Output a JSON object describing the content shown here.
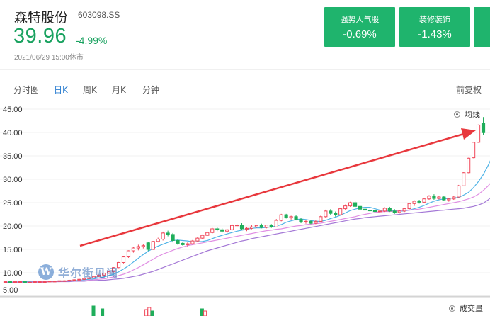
{
  "stock": {
    "name": "森特股份",
    "code": "603098.SS",
    "price": "39.96",
    "change": "-4.99%",
    "timestamp": "2021/06/29 15:00休市"
  },
  "sectors": [
    {
      "name": "强势人气股",
      "value": "-0.69%"
    },
    {
      "name": "装修装饰",
      "value": "-1.43%"
    },
    {
      "name": "",
      "value": ""
    }
  ],
  "tabs": [
    {
      "label": "分时图",
      "active": false
    },
    {
      "label": "日K",
      "active": true
    },
    {
      "label": "周K",
      "active": false
    },
    {
      "label": "月K",
      "active": false
    },
    {
      "label": "分钟",
      "active": false
    }
  ],
  "adjust_label": "前复权",
  "legend": {
    "ma": "均线",
    "volume": "成交量"
  },
  "watermark": {
    "logo": "W",
    "text": "华尔街见闻"
  },
  "colors": {
    "up": "#f0485a",
    "down": "#1fae5b",
    "price": "#1aa260",
    "sector_bg": "#1fb46d",
    "active_tab": "#2f80d1",
    "arrow": "#e8383d"
  },
  "chart_data": {
    "type": "candlestick",
    "y_ticks": [
      "45.00",
      "40.00",
      "35.00",
      "30.00",
      "25.00",
      "20.00",
      "15.00",
      "10.00",
      "5.00"
    ],
    "ylim": [
      5,
      45
    ],
    "candles": [
      [
        8.0,
        8.1,
        7.9,
        8.1
      ],
      [
        8.1,
        8.2,
        8.0,
        8.0
      ],
      [
        8.0,
        8.1,
        7.9,
        8.1
      ],
      [
        8.1,
        8.2,
        8.0,
        8.1
      ],
      [
        8.1,
        8.2,
        8.0,
        8.0
      ],
      [
        8.0,
        8.1,
        7.9,
        8.0
      ],
      [
        8.0,
        8.1,
        7.9,
        8.1
      ],
      [
        8.1,
        8.2,
        8.0,
        8.1
      ],
      [
        8.1,
        8.2,
        8.0,
        8.1
      ],
      [
        8.1,
        8.2,
        8.0,
        8.2
      ],
      [
        8.2,
        8.3,
        8.1,
        8.2
      ],
      [
        8.2,
        8.3,
        8.1,
        8.3
      ],
      [
        8.3,
        8.4,
        8.2,
        8.3
      ],
      [
        8.3,
        8.5,
        8.2,
        8.4
      ],
      [
        8.4,
        8.6,
        8.3,
        8.5
      ],
      [
        8.5,
        8.7,
        8.4,
        8.6
      ],
      [
        8.6,
        8.8,
        8.5,
        8.8
      ],
      [
        8.8,
        9.0,
        8.7,
        8.9
      ],
      [
        8.9,
        9.3,
        8.8,
        9.2
      ],
      [
        9.2,
        9.6,
        9.1,
        9.5
      ],
      [
        9.5,
        10.0,
        9.4,
        9.9
      ],
      [
        9.9,
        10.4,
        9.8,
        10.2
      ],
      [
        10.2,
        11.2,
        10.1,
        11.1
      ],
      [
        11.1,
        12.3,
        11.0,
        12.2
      ],
      [
        12.2,
        13.5,
        12.0,
        13.4
      ],
      [
        13.4,
        14.8,
        13.2,
        14.7
      ],
      [
        14.7,
        15.6,
        14.3,
        15.3
      ],
      [
        15.3,
        16.0,
        14.8,
        15.6
      ],
      [
        15.6,
        16.2,
        15.2,
        15.8
      ],
      [
        16.4,
        16.6,
        14.7,
        15.0
      ],
      [
        15.0,
        16.8,
        14.9,
        16.7
      ],
      [
        16.7,
        17.5,
        16.5,
        17.2
      ],
      [
        17.2,
        18.8,
        16.9,
        18.5
      ],
      [
        18.5,
        19.0,
        17.8,
        18.2
      ],
      [
        18.2,
        18.5,
        16.5,
        16.9
      ],
      [
        16.9,
        17.1,
        16.0,
        16.3
      ],
      [
        16.3,
        16.5,
        15.8,
        16.0
      ],
      [
        16.0,
        16.5,
        15.6,
        16.2
      ],
      [
        16.2,
        17.0,
        16.0,
        16.8
      ],
      [
        16.8,
        17.6,
        16.6,
        17.4
      ],
      [
        17.4,
        18.2,
        17.2,
        18.0
      ],
      [
        18.0,
        18.8,
        17.9,
        18.6
      ],
      [
        18.6,
        19.6,
        18.4,
        19.4
      ],
      [
        19.4,
        19.8,
        18.9,
        19.2
      ],
      [
        19.2,
        19.5,
        18.6,
        18.9
      ],
      [
        18.9,
        19.4,
        18.5,
        19.2
      ],
      [
        19.2,
        20.4,
        19.0,
        20.1
      ],
      [
        20.1,
        20.5,
        19.7,
        20.2
      ],
      [
        20.2,
        20.6,
        19.2,
        19.4
      ],
      [
        19.4,
        19.8,
        18.9,
        19.5
      ],
      [
        19.5,
        20.2,
        19.3,
        19.8
      ],
      [
        19.8,
        20.3,
        19.6,
        20.1
      ],
      [
        20.1,
        20.5,
        19.5,
        19.7
      ],
      [
        19.7,
        20.3,
        19.5,
        20.2
      ],
      [
        20.2,
        20.4,
        19.6,
        19.8
      ],
      [
        19.8,
        21.5,
        19.7,
        21.2
      ],
      [
        21.2,
        22.6,
        21.0,
        22.4
      ],
      [
        22.4,
        22.6,
        21.6,
        21.8
      ],
      [
        21.8,
        22.2,
        21.4,
        22.0
      ],
      [
        22.0,
        22.4,
        21.2,
        21.4
      ],
      [
        21.4,
        21.7,
        20.6,
        20.9
      ],
      [
        20.9,
        21.3,
        20.5,
        21.0
      ],
      [
        21.0,
        21.2,
        20.4,
        20.6
      ],
      [
        20.6,
        21.2,
        20.4,
        21.0
      ],
      [
        21.0,
        22.2,
        20.9,
        22.0
      ],
      [
        22.0,
        23.5,
        21.8,
        23.2
      ],
      [
        23.2,
        23.6,
        22.4,
        22.7
      ],
      [
        22.7,
        23.1,
        22.0,
        22.4
      ],
      [
        22.4,
        23.9,
        22.3,
        23.7
      ],
      [
        23.7,
        24.6,
        23.5,
        24.3
      ],
      [
        24.3,
        25.2,
        24.1,
        25.0
      ],
      [
        25.0,
        25.3,
        24.0,
        24.2
      ],
      [
        24.2,
        24.5,
        23.4,
        23.6
      ],
      [
        23.6,
        23.9,
        23.1,
        23.4
      ],
      [
        23.4,
        23.8,
        23.0,
        23.3
      ],
      [
        23.3,
        23.6,
        22.8,
        23.1
      ],
      [
        23.1,
        23.5,
        22.7,
        23.2
      ],
      [
        23.2,
        24.0,
        23.0,
        23.8
      ],
      [
        23.8,
        24.1,
        23.0,
        23.2
      ],
      [
        23.2,
        23.6,
        22.6,
        22.9
      ],
      [
        22.9,
        23.4,
        22.7,
        23.2
      ],
      [
        23.2,
        23.9,
        23.0,
        23.7
      ],
      [
        23.7,
        25.0,
        23.6,
        24.8
      ],
      [
        24.8,
        25.5,
        24.3,
        25.3
      ],
      [
        25.3,
        25.6,
        24.8,
        25.1
      ],
      [
        25.1,
        26.0,
        24.9,
        25.8
      ],
      [
        25.8,
        26.6,
        25.6,
        26.4
      ],
      [
        26.4,
        26.8,
        25.6,
        25.9
      ],
      [
        25.9,
        26.4,
        25.7,
        26.2
      ],
      [
        26.2,
        26.5,
        25.4,
        25.6
      ],
      [
        25.6,
        26.0,
        25.2,
        25.8
      ],
      [
        25.8,
        26.5,
        25.6,
        26.2
      ],
      [
        26.2,
        28.8,
        26.1,
        28.6
      ],
      [
        28.6,
        31.5,
        28.5,
        31.4
      ],
      [
        31.4,
        34.6,
        31.3,
        34.5
      ],
      [
        34.6,
        38.0,
        34.5,
        37.9
      ],
      [
        37.9,
        41.7,
        37.8,
        41.6
      ],
      [
        42.0,
        43.3,
        39.5,
        39.96
      ]
    ],
    "ma5": [
      8.0,
      8.0,
      8.0,
      8.1,
      8.1,
      8.1,
      8.1,
      8.1,
      8.1,
      8.1,
      8.1,
      8.2,
      8.2,
      8.3,
      8.3,
      8.4,
      8.5,
      8.6,
      8.7,
      8.9,
      9.1,
      9.4,
      9.7,
      10.2,
      10.8,
      11.5,
      12.3,
      13.1,
      13.9,
      14.6,
      15.2,
      15.7,
      16.1,
      16.5,
      16.9,
      17.0,
      16.9,
      16.8,
      16.6,
      16.6,
      16.7,
      16.9,
      17.3,
      17.7,
      18.0,
      18.3,
      18.6,
      18.9,
      19.1,
      19.3,
      19.5,
      19.6,
      19.6,
      19.7,
      19.8,
      20.0,
      20.3,
      20.8,
      21.1,
      21.4,
      21.5,
      21.4,
      21.2,
      21.0,
      21.0,
      21.2,
      21.6,
      21.9,
      22.3,
      22.8,
      23.3,
      23.6,
      23.9,
      24.0,
      24.0,
      23.7,
      23.4,
      23.3,
      23.3,
      23.3,
      23.2,
      23.2,
      23.4,
      23.7,
      24.0,
      24.4,
      24.9,
      25.3,
      25.6,
      25.8,
      25.9,
      26.0,
      26.1,
      26.6,
      27.2,
      28.2,
      29.5,
      31.0,
      33.0,
      35.3,
      37.4
    ],
    "ma10": [
      8.0,
      8.0,
      8.0,
      8.0,
      8.0,
      8.0,
      8.1,
      8.1,
      8.1,
      8.1,
      8.1,
      8.1,
      8.2,
      8.2,
      8.2,
      8.3,
      8.3,
      8.4,
      8.5,
      8.6,
      8.7,
      8.9,
      9.1,
      9.4,
      9.7,
      10.1,
      10.6,
      11.1,
      11.7,
      12.3,
      12.9,
      13.5,
      14.0,
      14.4,
      14.8,
      15.2,
      15.5,
      15.8,
      16.0,
      16.2,
      16.4,
      16.6,
      16.8,
      17.0,
      17.2,
      17.4,
      17.6,
      17.8,
      18.0,
      18.2,
      18.4,
      18.6,
      18.8,
      19.0,
      19.1,
      19.3,
      19.4,
      19.6,
      19.8,
      20.0,
      20.1,
      20.3,
      20.4,
      20.5,
      20.6,
      20.8,
      21.0,
      21.2,
      21.4,
      21.6,
      21.8,
      22.0,
      22.3,
      22.5,
      22.7,
      22.9,
      23.0,
      23.1,
      23.1,
      23.2,
      23.3,
      23.3,
      23.4,
      23.5,
      23.6,
      23.8,
      24.0,
      24.2,
      24.4,
      24.6,
      24.8,
      25.0,
      25.2,
      25.5,
      25.8,
      26.2,
      26.8,
      27.6,
      28.6,
      29.8,
      31.2
    ],
    "ma20": [
      8.0,
      8.0,
      8.0,
      8.0,
      8.0,
      8.0,
      8.0,
      8.0,
      8.0,
      8.1,
      8.1,
      8.1,
      8.1,
      8.1,
      8.2,
      8.2,
      8.2,
      8.3,
      8.3,
      8.4,
      8.4,
      8.5,
      8.6,
      8.7,
      8.8,
      9.0,
      9.2,
      9.4,
      9.7,
      10.0,
      10.3,
      10.7,
      11.1,
      11.5,
      11.9,
      12.3,
      12.7,
      13.1,
      13.5,
      13.9,
      14.3,
      14.7,
      15.0,
      15.3,
      15.6,
      15.9,
      16.2,
      16.5,
      16.8,
      17.0,
      17.3,
      17.5,
      17.7,
      17.9,
      18.1,
      18.3,
      18.5,
      18.7,
      18.9,
      19.1,
      19.3,
      19.5,
      19.7,
      19.9,
      20.1,
      20.3,
      20.5,
      20.7,
      20.9,
      21.1,
      21.3,
      21.5,
      21.6,
      21.8,
      21.9,
      22.0,
      22.1,
      22.2,
      22.3,
      22.4,
      22.5,
      22.6,
      22.7,
      22.8,
      22.9,
      23.0,
      23.1,
      23.2,
      23.3,
      23.4,
      23.5,
      23.6,
      23.7,
      23.8,
      24.0,
      24.2,
      24.5,
      24.9,
      25.6,
      26.6,
      28.2
    ],
    "volume": [
      0,
      0,
      0,
      0,
      0,
      0,
      0,
      0,
      0,
      0,
      0,
      0,
      0,
      0,
      0,
      0,
      0,
      0,
      0,
      0,
      0,
      0,
      0,
      0,
      0,
      0,
      0,
      0,
      0,
      0,
      0,
      0,
      0,
      0,
      0,
      0,
      0,
      0,
      0,
      0,
      0,
      0,
      0,
      0,
      0,
      0,
      0,
      0,
      0,
      0,
      0,
      0,
      0,
      0,
      0,
      0,
      0,
      0,
      0,
      0,
      0,
      0,
      0,
      0,
      0,
      0,
      0,
      0,
      0,
      0,
      0,
      0,
      0,
      0,
      0,
      0,
      0,
      0,
      0,
      0,
      0,
      0,
      0,
      0,
      0,
      0,
      0,
      0,
      0,
      0,
      0,
      0,
      0,
      0,
      0,
      0,
      0,
      0,
      0,
      0,
      0
    ]
  }
}
